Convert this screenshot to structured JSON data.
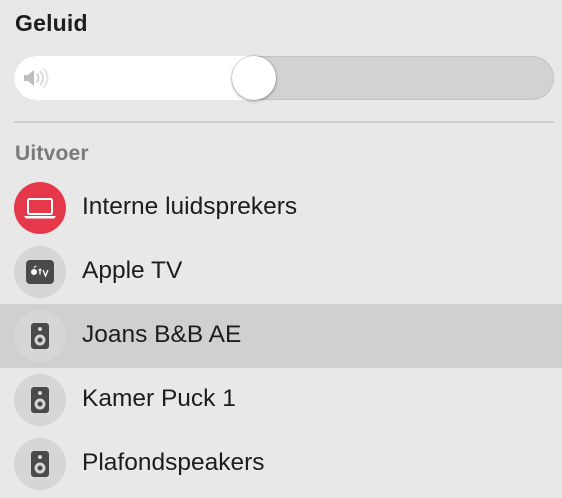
{
  "sound": {
    "title": "Geluid",
    "volume": 0.44,
    "speaker_icon": "speaker-volume-icon"
  },
  "output": {
    "title": "Uitvoer",
    "devices": [
      {
        "label": "Interne luidsprekers",
        "icon": "laptop-icon",
        "active": true,
        "selected": false
      },
      {
        "label": "Apple TV",
        "icon": "apple-tv-icon",
        "active": false,
        "selected": false
      },
      {
        "label": "Joans B&B AE",
        "icon": "speaker-icon",
        "active": false,
        "selected": true
      },
      {
        "label": "Kamer Puck 1",
        "icon": "speaker-icon",
        "active": false,
        "selected": false
      },
      {
        "label": "Plafondspeakers",
        "icon": "speaker-icon",
        "active": false,
        "selected": false
      }
    ]
  },
  "colors": {
    "background": "#e8e8e8",
    "active_device": "#e5394b",
    "selected_row": "#d0d0d0"
  }
}
